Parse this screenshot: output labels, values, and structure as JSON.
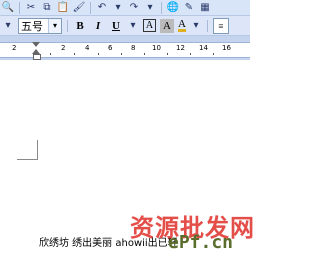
{
  "toolbar": {
    "font_size": "五号"
  },
  "ruler": {
    "numbers": [
      "2",
      "2",
      "4",
      "6",
      "8",
      "10",
      "12",
      "14",
      "16"
    ]
  },
  "document": {
    "text": "欣绣坊  绣出美丽  ahowii出已轩"
  },
  "watermark": {
    "main": "资源批发网",
    "sub": "ePf.cn"
  }
}
